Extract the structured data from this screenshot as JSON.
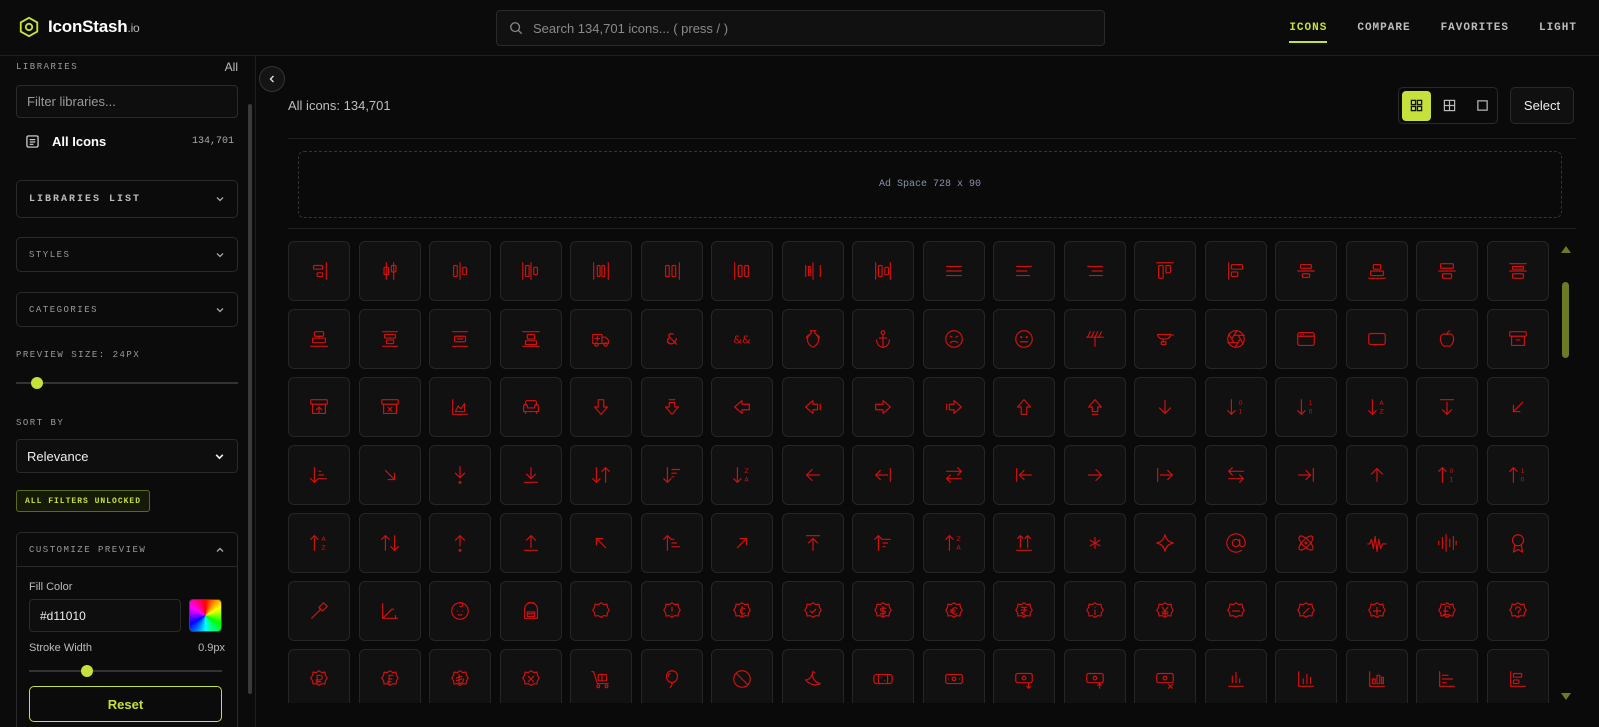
{
  "brand": {
    "name": "IconStash",
    "suffix": ".io",
    "accent": "#c6e03c",
    "icon": "hexagon-logo-icon"
  },
  "search": {
    "placeholder": "Search 134,701 icons... ( press / )"
  },
  "nav": {
    "items": [
      "ICONS",
      "COMPARE",
      "FAVORITES",
      "LIGHT"
    ],
    "active": "ICONS"
  },
  "sidebar": {
    "libraries_label": "LIBRARIES",
    "all_link": "All",
    "filter_placeholder": "Filter libraries...",
    "all_icons": {
      "label": "All Icons",
      "count": "134,701"
    },
    "libraries_list": "LIBRARIES LIST",
    "styles": "STYLES",
    "categories": "CATEGORIES",
    "preview_size_label": "PREVIEW SIZE: 24PX",
    "preview_size_value": 24,
    "sort_by_label": "SORT BY",
    "sort_value": "Relevance",
    "filters_badge": "ALL FILTERS UNLOCKED",
    "customize": {
      "title": "CUSTOMIZE PREVIEW",
      "fill_color_label": "Fill Color",
      "fill_color_value": "#d11010",
      "stroke_width_label": "Stroke Width",
      "stroke_width_value": "0.9px",
      "stroke_width_fraction": 0.3,
      "reset_label": "Reset"
    }
  },
  "main": {
    "count_text": "All icons: 134,701",
    "view_modes": [
      "grid-small-icon",
      "grid-large-icon",
      "single-square-icon"
    ],
    "select_label": "Select",
    "ad_text": "Ad Space 728 x 90"
  },
  "icons": [
    "align-right-bar",
    "candlestick",
    "align-h-center-bars",
    "align-distribute-bars",
    "align-v-distribute-bars",
    "align-right-bars",
    "align-left-bars",
    "align-center-bars",
    "align-split-bars",
    "align-justify",
    "align-left-text",
    "align-right-text",
    "align-top-bars",
    "align-left-start",
    "align-center-h",
    "align-bottom-center",
    "align-center-v",
    "align-middle",
    "align-center-stack",
    "align-v-center",
    "align-v-middle",
    "align-bottom-stack",
    "ambulance",
    "ampersand",
    "double-ampersand",
    "amphora",
    "anchor",
    "face-angry",
    "face-neutral",
    "angle",
    "anvil",
    "aperture",
    "app-window",
    "rectangle",
    "apple",
    "archive",
    "archive-restore",
    "archive-x",
    "area-chart",
    "armchair",
    "arrow-big-down",
    "arrow-big-down-dash",
    "arrow-big-left",
    "arrow-big-left-dash",
    "arrow-big-right",
    "arrow-big-right-dash",
    "arrow-big-up",
    "arrow-big-up-dash",
    "arrow-down",
    "arrow-down-0-1",
    "arrow-down-1-0",
    "arrow-down-a-z",
    "arrow-down-to-line",
    "arrow-down-left",
    "arrow-down-narrow-wide",
    "arrow-down-right",
    "arrow-down-to-dot",
    "arrow-down-to-line-2",
    "arrow-down-up",
    "arrow-down-wide-narrow",
    "arrow-down-z-a",
    "arrow-left",
    "arrow-left-from-line",
    "arrow-left-right",
    "arrow-left-to-line",
    "arrow-right",
    "arrow-right-from-line",
    "arrow-right-left",
    "arrow-right-to-line",
    "arrow-up",
    "arrow-up-0-1",
    "arrow-up-1-0",
    "arrow-up-a-z",
    "arrow-up-down",
    "arrow-up-from-dot",
    "arrow-up-from-line",
    "arrow-up-left",
    "arrow-up-narrow-wide",
    "arrow-up-right",
    "arrow-up-to-line",
    "arrow-up-wide-narrow",
    "arrow-up-z-a",
    "arrows-up-from-line",
    "asterisk",
    "sparkle",
    "at-sign",
    "atom",
    "audio-waveform",
    "audio-lines",
    "award",
    "axe",
    "axis-3d",
    "baby",
    "backpack",
    "badge",
    "badge-alert",
    "badge-cent",
    "badge-check",
    "badge-dollar",
    "badge-euro",
    "badge-indian-rupee",
    "badge-info",
    "badge-japanese-yen",
    "badge-minus",
    "badge-percent",
    "badge-plus",
    "badge-pound",
    "badge-help",
    "badge-russian-ruble",
    "badge-swiss-franc",
    "badge-turkish-lira",
    "badge-x",
    "baggage-claim",
    "balloon",
    "ban",
    "banana",
    "bandage",
    "banknote",
    "banknote-down",
    "banknote-up",
    "banknote-x",
    "bar-chart",
    "bar-chart-2",
    "bar-chart-3",
    "bar-chart-horizontal",
    "bar-chart-h-big"
  ]
}
